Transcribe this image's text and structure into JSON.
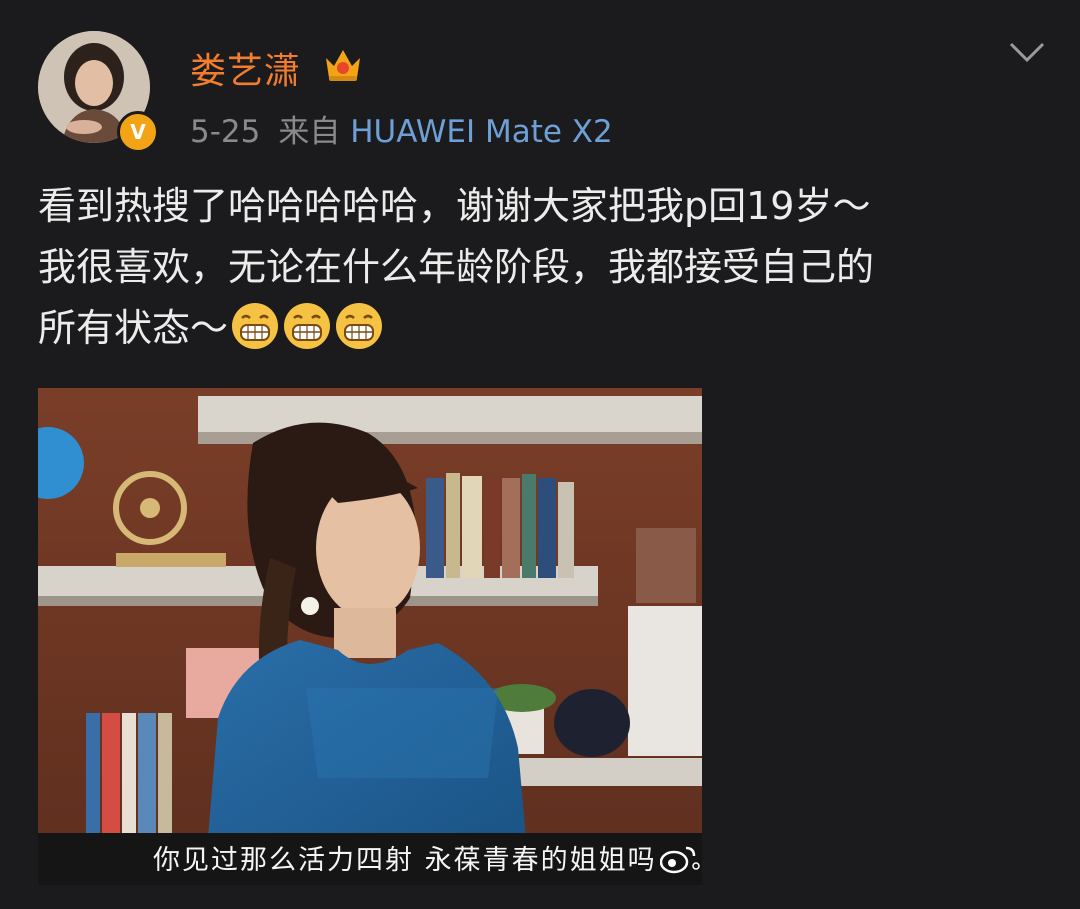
{
  "post": {
    "username": "娄艺潇",
    "date": "5-25",
    "from_label": "来自",
    "device": "HUAWEI Mate X2",
    "text_line1": "看到热搜了哈哈哈哈哈，谢谢大家把我p回19岁～",
    "text_line2": "我很喜欢，无论在什么年龄阶段，我都接受自己的",
    "text_line3": "所有状态～",
    "emojis": [
      "grin-emoji",
      "grin-emoji",
      "grin-emoji"
    ]
  },
  "image": {
    "subtitle": "你见过那么活力四射 永葆青春的姐姐吗"
  },
  "colors": {
    "background": "#1b1b1d",
    "username": "#f27d2d",
    "device": "#6e9fd6",
    "badge": "#f2a316"
  }
}
